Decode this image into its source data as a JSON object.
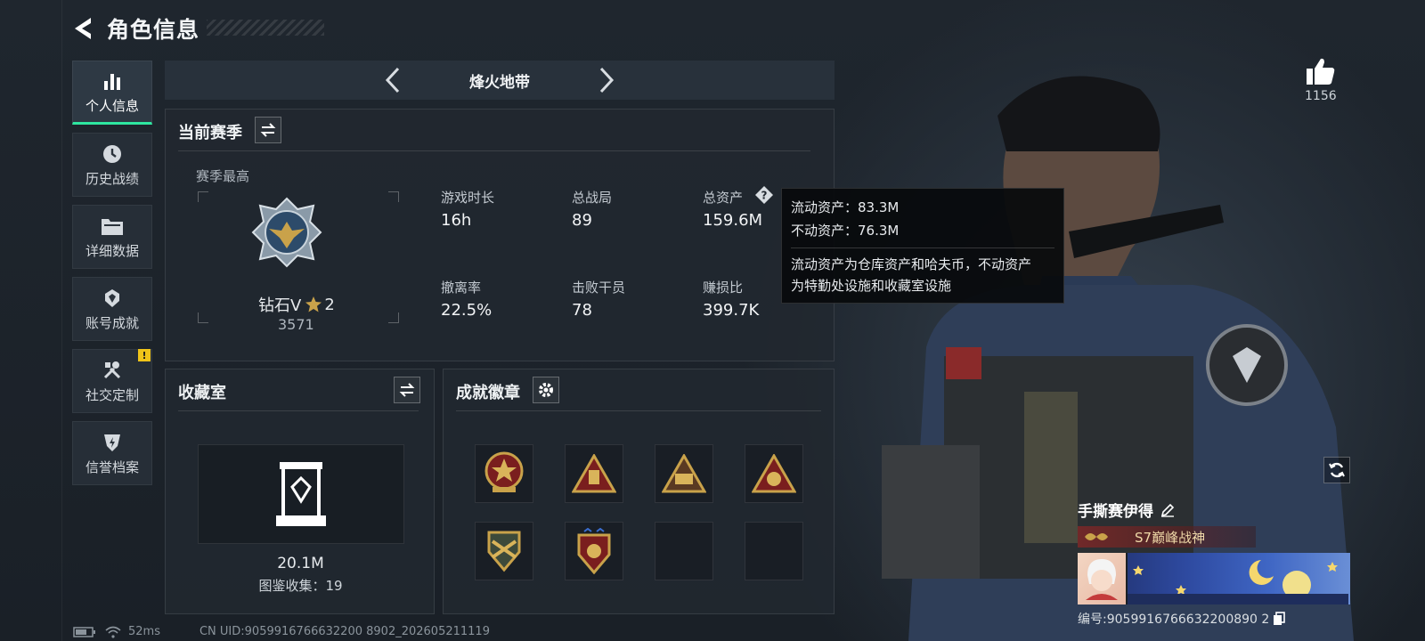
{
  "header": {
    "title": "角色信息"
  },
  "sidebar": {
    "items": [
      {
        "label": "个人信息",
        "icon": "bar-chart-icon",
        "active": true
      },
      {
        "label": "历史战绩",
        "icon": "clock-icon"
      },
      {
        "label": "详细数据",
        "icon": "folder-icon"
      },
      {
        "label": "账号成就",
        "icon": "achievement-icon"
      },
      {
        "label": "社交定制",
        "icon": "tools-icon",
        "badge": "!"
      },
      {
        "label": "信誉档案",
        "icon": "reputation-icon"
      }
    ]
  },
  "mode": {
    "label": "烽火地带"
  },
  "season": {
    "title": "当前赛季",
    "best_label": "赛季最高",
    "rank_name": "钻石V",
    "rank_stars": "2",
    "rank_score": "3571",
    "stats": [
      {
        "label": "游戏时长",
        "value": "16h"
      },
      {
        "label": "总战局",
        "value": "89"
      },
      {
        "label": "总资产",
        "value": "159.6M"
      },
      {
        "label": "撤离率",
        "value": "22.5%"
      },
      {
        "label": "击败干员",
        "value": "78"
      },
      {
        "label": "赚损比",
        "value": "399.7K"
      }
    ]
  },
  "tooltip": {
    "liquid": "流动资产：83.3M",
    "fixed": "不动资产：76.3M",
    "desc_line1": "流动资产为仓库资产和哈夫币，不动资产",
    "desc_line2": "为特勤处设施和收藏室设施"
  },
  "collection": {
    "title": "收藏室",
    "value": "20.1M",
    "count": "图鉴收集：19"
  },
  "achievements": {
    "title": "成就徽章"
  },
  "player": {
    "likes": "1156",
    "name": "手撕赛伊得",
    "honor_title": "S7巅峰战神",
    "uid_label": "编号:9059916766632200890 2"
  },
  "status": {
    "ping": "52ms",
    "uid_line": "CN UID:9059916766632200 8902_202605211119"
  },
  "colors": {
    "accent": "#2ee6a0",
    "warning": "#f0c419",
    "gold": "#c9a24a"
  }
}
